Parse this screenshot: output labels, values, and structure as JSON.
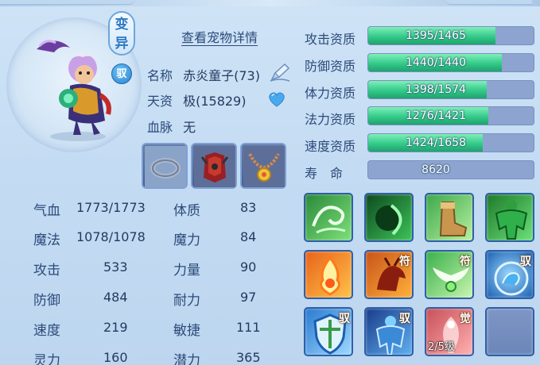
{
  "detail_link": "查看宠物详情",
  "badges": {
    "variant_1": "变",
    "variant_2": "异",
    "yu": "驭"
  },
  "pet": {
    "name_label": "名称",
    "name_value": "赤炎童子(73)",
    "talent_label": "天资",
    "talent_value": "极(15829)",
    "bloodline_label": "血脉",
    "bloodline_value": "无"
  },
  "stats": [
    {
      "label": "气血",
      "value": "1773/1773"
    },
    {
      "label": "体质",
      "value": "83"
    },
    {
      "label": "魔法",
      "value": "1078/1078"
    },
    {
      "label": "魔力",
      "value": "84"
    },
    {
      "label": "攻击",
      "value": "533"
    },
    {
      "label": "力量",
      "value": "90"
    },
    {
      "label": "防御",
      "value": "484"
    },
    {
      "label": "耐力",
      "value": "97"
    },
    {
      "label": "速度",
      "value": "219"
    },
    {
      "label": "敏捷",
      "value": "111"
    },
    {
      "label": "灵力",
      "value": "160"
    },
    {
      "label": "潜力",
      "value": "365"
    }
  ],
  "aptitudes": [
    {
      "label": "攻击资质",
      "text": "1395/1465",
      "fraction": 0.952
    },
    {
      "label": "防御资质",
      "text": "1440/1440",
      "fraction": 1.0
    },
    {
      "label": "体力资质",
      "text": "1398/1574",
      "fraction": 0.888
    },
    {
      "label": "法力资质",
      "text": "1276/1421",
      "fraction": 0.898
    },
    {
      "label": "速度资质",
      "text": "1424/1658",
      "fraction": 0.859
    },
    {
      "label": "寿　命",
      "text": "8620",
      "fraction": 0
    }
  ],
  "skill_tags": {
    "fu": "符",
    "yu": "驭",
    "jue": "觉",
    "level": "2/5级"
  },
  "colors": {
    "bar_fill": "#34c98a",
    "bar_empty": "#8ea4d0",
    "text": "#2c4a7a"
  }
}
